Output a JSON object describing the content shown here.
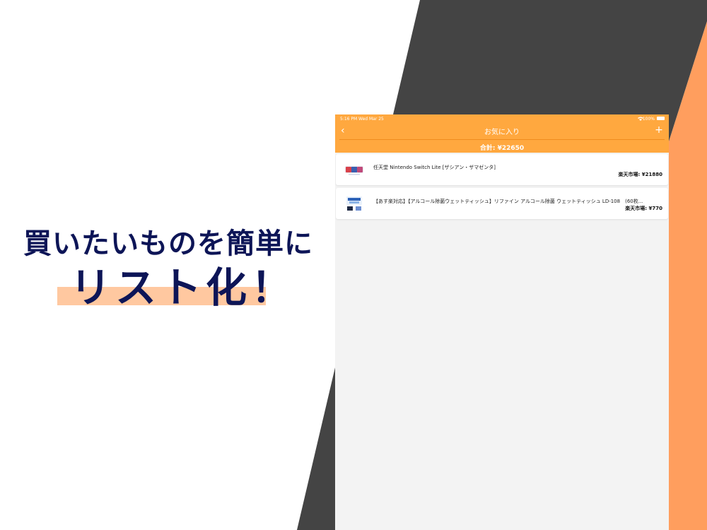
{
  "headline": {
    "line1": "買いたいものを簡単に",
    "line2": "リスト化！"
  },
  "colors": {
    "accent": "#ffa83f",
    "dark": "#444444",
    "navy": "#0d1557",
    "highlight": "#ffc8a0",
    "orange_stripe": "#ff9e5e"
  },
  "status_bar": {
    "time": "5:16 PM",
    "date": "Wed Mar 25",
    "battery": "100%"
  },
  "navbar": {
    "back_icon": "‹",
    "title": "お気に入り",
    "add_icon": "+"
  },
  "total": "合計: ¥22650",
  "items": [
    {
      "title": "任天堂 Nintendo Switch Lite [ザシアン・ザマゼンタ]",
      "price": "楽天市場: ¥21880",
      "thumb_icon": "game-console-thumbnail"
    },
    {
      "title": "【あす楽対応】【アルコール除菌ウェットティッシュ】リファイン アルコール除菌 ウェットティッシュ LD-108　(60枚...",
      "price": "楽天市場: ¥770",
      "thumb_icon": "wet-tissue-thumbnail"
    }
  ]
}
